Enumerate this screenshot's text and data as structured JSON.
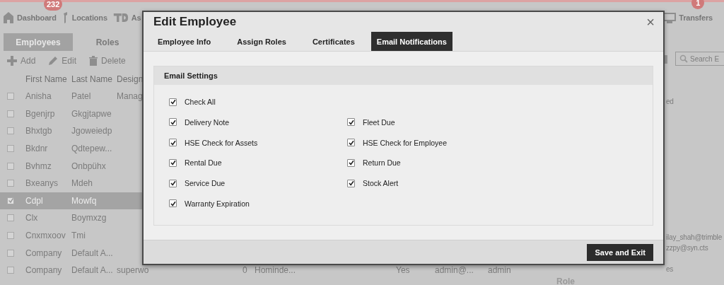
{
  "nav": {
    "items": [
      {
        "label": "Dashboard",
        "badge": "232"
      },
      {
        "label": "Locations"
      },
      {
        "label": "As"
      }
    ],
    "right": {
      "label": "Transfers",
      "badge": "1"
    }
  },
  "tabs": [
    {
      "label": "Employees",
      "selected": true
    },
    {
      "label": "Roles",
      "selected": false
    }
  ],
  "toolbar": [
    "Add",
    "Edit",
    "Delete"
  ],
  "search": {
    "placeholder": "Search E"
  },
  "table": {
    "columns": [
      "First Name",
      "Last Name",
      "Design"
    ],
    "rows": [
      {
        "selected": false,
        "cells": [
          "Anisha",
          "Patel",
          "Manag"
        ]
      },
      {
        "selected": false,
        "cells": [
          "Bgenjrp",
          "Gkgjtapwe"
        ]
      },
      {
        "selected": false,
        "cells": [
          "Bhxtgb",
          "Jgoweiedp"
        ]
      },
      {
        "selected": false,
        "cells": [
          "Bkdnr",
          "Qdtepew..."
        ]
      },
      {
        "selected": false,
        "cells": [
          "Bvhmz",
          "Onbpühx"
        ]
      },
      {
        "selected": false,
        "cells": [
          "Bxeanys",
          "Mdeh"
        ]
      },
      {
        "selected": true,
        "cells": [
          "Cdpl",
          "Mowfq"
        ]
      },
      {
        "selected": false,
        "cells": [
          "Clx",
          "Boymxzg"
        ]
      },
      {
        "selected": false,
        "cells": [
          "Cnxmxoov",
          "Tmi"
        ]
      },
      {
        "selected": false,
        "cells": [
          "Company",
          "Default A..."
        ]
      },
      {
        "selected": false,
        "cells": [
          "Company",
          "Default A...",
          "superwo",
          "0",
          "Hominde...",
          "Yes",
          "admin@...",
          "admin"
        ]
      }
    ],
    "footer_label": "Role"
  },
  "side_texts": [
    "ed",
    "ilay_shah@trimble",
    "zzpy@syn.cts",
    "es"
  ],
  "modal": {
    "title": "Edit Employee",
    "close": "×",
    "tabs": [
      {
        "label": "Employee Info",
        "selected": false
      },
      {
        "label": "Assign Roles",
        "selected": false
      },
      {
        "label": "Certificates",
        "selected": false
      },
      {
        "label": "Email Notifications",
        "selected": true
      }
    ],
    "section_title": "Email Settings",
    "check_all": {
      "label": "Check All",
      "checked": true
    },
    "options": [
      {
        "label": "Delivery Note",
        "checked": true
      },
      {
        "label": "Fleet Due",
        "checked": true
      },
      {
        "label": "HSE Check for Assets",
        "checked": true
      },
      {
        "label": "HSE Check for Employee",
        "checked": true
      },
      {
        "label": "Rental Due",
        "checked": true
      },
      {
        "label": "Return Due",
        "checked": true
      },
      {
        "label": "Service Due",
        "checked": true
      },
      {
        "label": "Stock Alert",
        "checked": true
      },
      {
        "label": "Warranty Expiration",
        "checked": true
      }
    ],
    "save_button": "Save and Exit"
  }
}
